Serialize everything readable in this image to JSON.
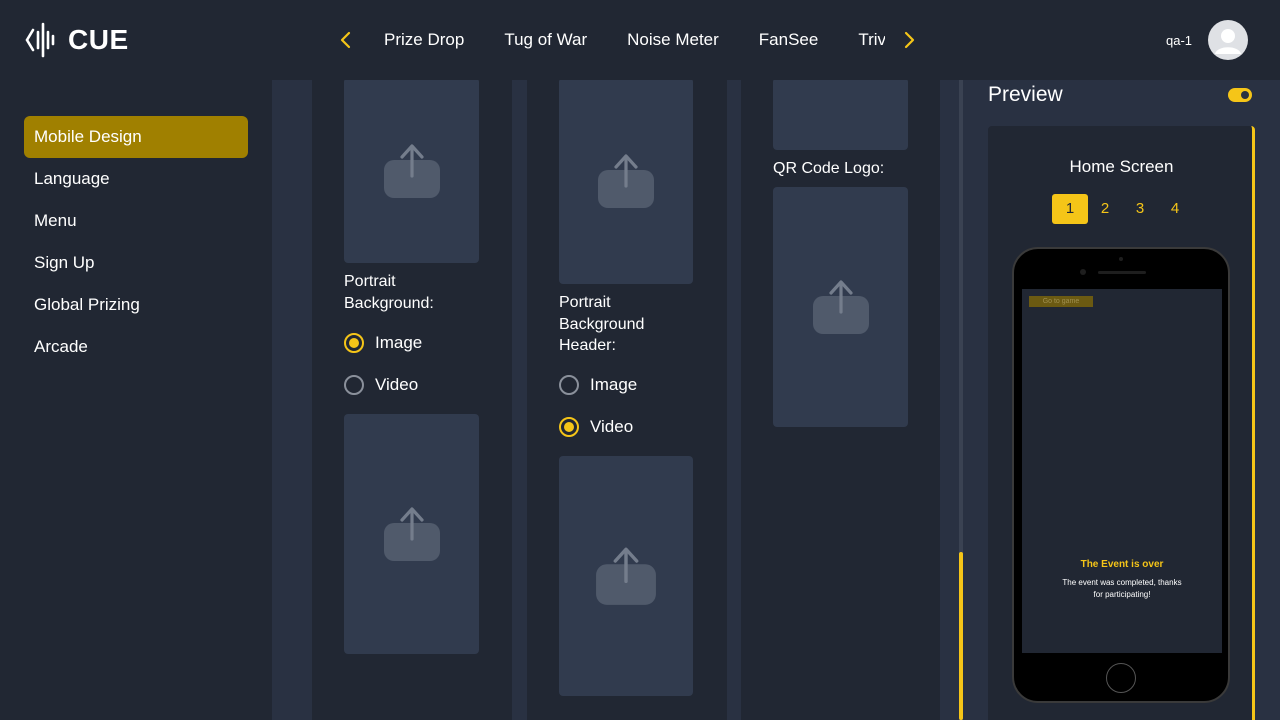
{
  "header": {
    "logo_text": "CUE",
    "game_tabs": [
      "Prize Drop",
      "Tug of War",
      "Noise Meter",
      "FanSee",
      "Trivia"
    ],
    "user_name": "qa-1"
  },
  "sidebar": {
    "items": [
      {
        "label": "Mobile Design",
        "active": true
      },
      {
        "label": "Language",
        "active": false
      },
      {
        "label": "Menu",
        "active": false
      },
      {
        "label": "Sign Up",
        "active": false
      },
      {
        "label": "Global Prizing",
        "active": false
      },
      {
        "label": "Arcade",
        "active": false
      }
    ]
  },
  "main": {
    "col1": {
      "label": "Portrait\nBackground:",
      "options": [
        {
          "label": "Image",
          "checked": true
        },
        {
          "label": "Video",
          "checked": false
        }
      ]
    },
    "col2": {
      "label": "Portrait\nBackground\nHeader:",
      "options": [
        {
          "label": "Image",
          "checked": false
        },
        {
          "label": "Video",
          "checked": true
        }
      ]
    },
    "col3": {
      "label": "QR Code Logo:"
    }
  },
  "preview": {
    "title": "Preview",
    "toggle_on": true,
    "screen_title": "Home Screen",
    "pages": [
      "1",
      "2",
      "3",
      "4"
    ],
    "active_page": "1",
    "phone": {
      "goto_button": "Go to game",
      "event_title": "The Event is over",
      "event_message": "The event was completed, thanks for participating!"
    }
  },
  "colors": {
    "accent": "#f5c518",
    "sidebar_active": "#a08000",
    "background": "#212733",
    "panel": "#293142",
    "upload_box": "#313b4e"
  },
  "icons": {
    "upload": "upload-icon",
    "nav_left": "chevron-left-icon",
    "nav_right": "chevron-right-icon",
    "avatar": "user-icon"
  }
}
